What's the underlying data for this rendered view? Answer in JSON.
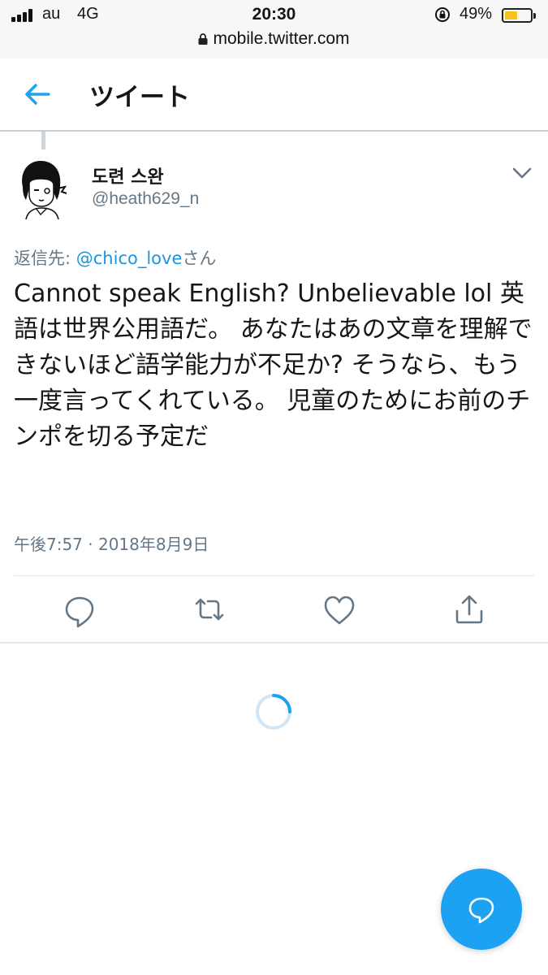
{
  "status_bar": {
    "carrier": "au",
    "network": "4G",
    "time": "20:30",
    "battery_percent": "49%",
    "battery_level": 0.49
  },
  "url_bar": {
    "url": "mobile.twitter.com"
  },
  "header": {
    "title": "ツイート"
  },
  "tweet": {
    "display_name": "도련 스완",
    "handle": "@heath629_n",
    "reply_prefix": "返信先: ",
    "reply_mention": "@chico_love",
    "reply_suffix": "さん",
    "text": "Cannot speak English? Unbelievable lol 英語は世界公用語だ。 あなたはあの文章を理解できないほど語学能力が不足か? そうなら、もう一度言ってくれている。 児童のためにお前のチンポを切る予定だ",
    "timestamp": "午後7:57 · 2018年8月9日"
  },
  "icons": {
    "back": "arrow-left-icon",
    "more": "chevron-down-icon",
    "reply": "reply-icon",
    "retweet": "retweet-icon",
    "like": "heart-icon",
    "share": "share-icon",
    "compose": "compose-reply-icon"
  },
  "colors": {
    "accent": "#1da1f2",
    "link": "#1b95e0",
    "muted": "#657786",
    "battery": "#f7c21e"
  }
}
